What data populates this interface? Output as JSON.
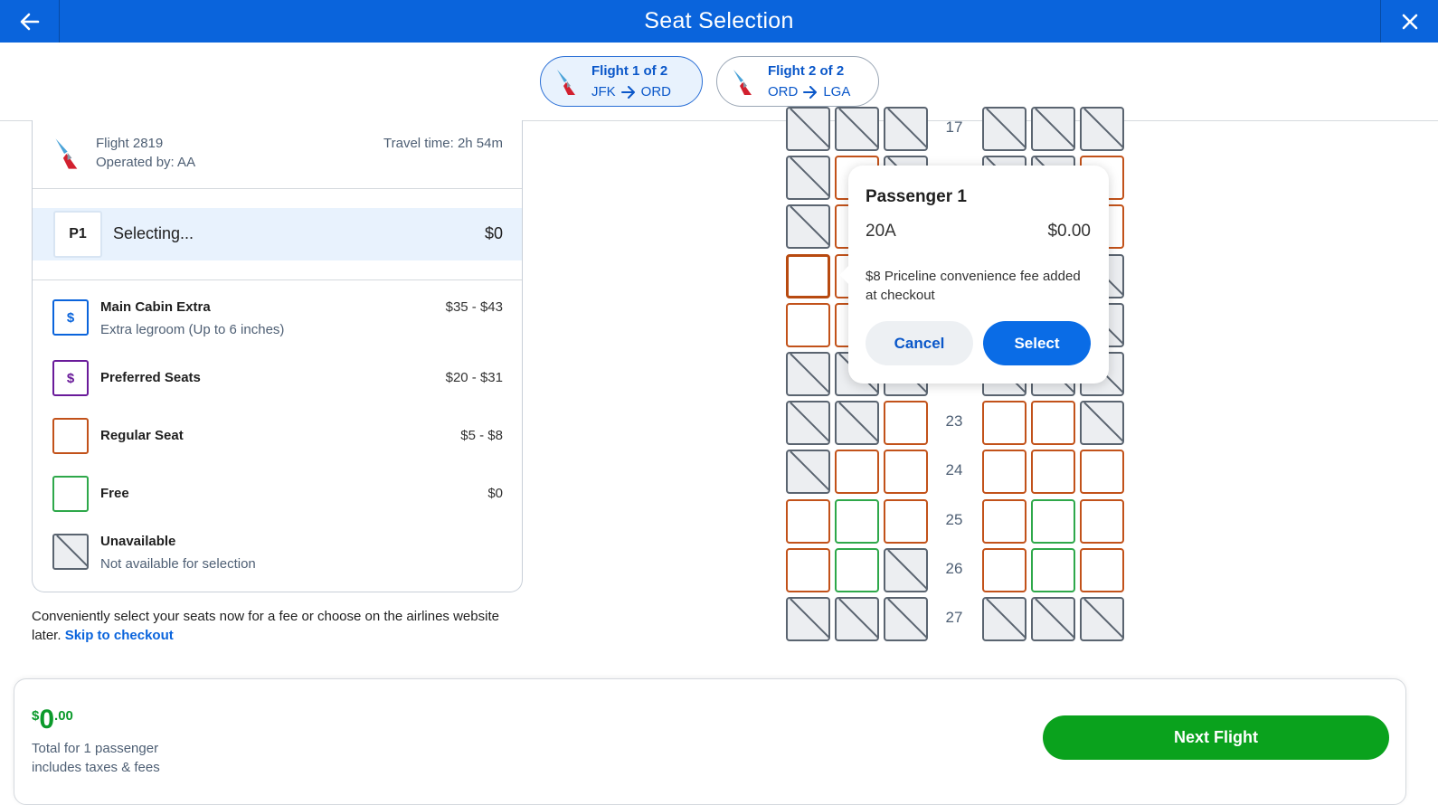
{
  "header": {
    "title": "Seat Selection",
    "back_icon": "arrow-left-icon",
    "close_icon": "close-icon"
  },
  "flight_tabs": [
    {
      "title": "Flight 1 of 2",
      "from": "JFK",
      "to": "ORD",
      "active": true
    },
    {
      "title": "Flight 2 of 2",
      "from": "ORD",
      "to": "LGA",
      "active": false
    }
  ],
  "flight_info": {
    "flight": "Flight 2819",
    "operated_by": "Operated by: AA",
    "travel_time": "Travel time: 2h 54m"
  },
  "passenger": {
    "badge": "P1",
    "status": "Selecting...",
    "price": "$0"
  },
  "legend": [
    {
      "name": "Main Cabin Extra",
      "desc": "Extra legroom (Up to 6 inches)",
      "range": "$35 - $43",
      "symbol": "$",
      "color": "#0a64dc"
    },
    {
      "name": "Preferred Seats",
      "desc": "",
      "range": "$20 - $31",
      "symbol": "$",
      "color": "#6a1b9a"
    },
    {
      "name": "Regular Seat",
      "desc": "",
      "range": "$5 - $8",
      "symbol": "",
      "color": "#c2521a"
    },
    {
      "name": "Free",
      "desc": "",
      "range": "$0",
      "symbol": "",
      "color": "#2ea84a"
    },
    {
      "name": "Unavailable",
      "desc": "Not available for selection",
      "range": "",
      "symbol": "",
      "color": "#5a6470"
    }
  ],
  "note": {
    "text": "Conveniently select your seats now for a fee or choose on the airlines website later.",
    "link": "Skip to checkout"
  },
  "seatmap": {
    "rows": [
      {
        "number": "17",
        "seats": [
          "un",
          "un",
          "un",
          "un",
          "un",
          "un"
        ]
      },
      {
        "number": "",
        "seats": [
          "un",
          "reg",
          "un",
          "un",
          "un",
          "reg"
        ]
      },
      {
        "number": "",
        "seats": [
          "un",
          "reg",
          "un",
          "un",
          "un",
          "reg"
        ]
      },
      {
        "number": "",
        "seats": [
          "sel",
          "reg",
          "reg",
          "un",
          "un",
          "un"
        ]
      },
      {
        "number": "",
        "seats": [
          "reg",
          "reg",
          "reg",
          "un",
          "un",
          "un"
        ]
      },
      {
        "number": "",
        "seats": [
          "un",
          "un",
          "un",
          "un",
          "un",
          "un"
        ]
      },
      {
        "number": "23",
        "seats": [
          "un",
          "un",
          "reg",
          "reg",
          "reg",
          "un"
        ]
      },
      {
        "number": "24",
        "seats": [
          "un",
          "reg",
          "reg",
          "reg",
          "reg",
          "reg"
        ]
      },
      {
        "number": "25",
        "seats": [
          "reg",
          "free",
          "reg",
          "reg",
          "free",
          "reg"
        ]
      },
      {
        "number": "26",
        "seats": [
          "reg",
          "free",
          "un",
          "reg",
          "free",
          "reg"
        ]
      },
      {
        "number": "27",
        "seats": [
          "un",
          "un",
          "un",
          "un",
          "un",
          "un"
        ]
      }
    ]
  },
  "popup": {
    "title": "Passenger 1",
    "seat": "20A",
    "price": "$0.00",
    "fee": "$8 Priceline convenience fee added at checkout",
    "cancel": "Cancel",
    "select": "Select"
  },
  "footer": {
    "currency": "$",
    "dollars": "0",
    "cents": ".00",
    "line1": "Total for 1 passenger",
    "line2": "includes taxes & fees",
    "next": "Next Flight"
  },
  "colors": {
    "brand": "#0a64dc",
    "success": "#0aa21d",
    "regular": "#c2521a",
    "free": "#2ea84a"
  }
}
